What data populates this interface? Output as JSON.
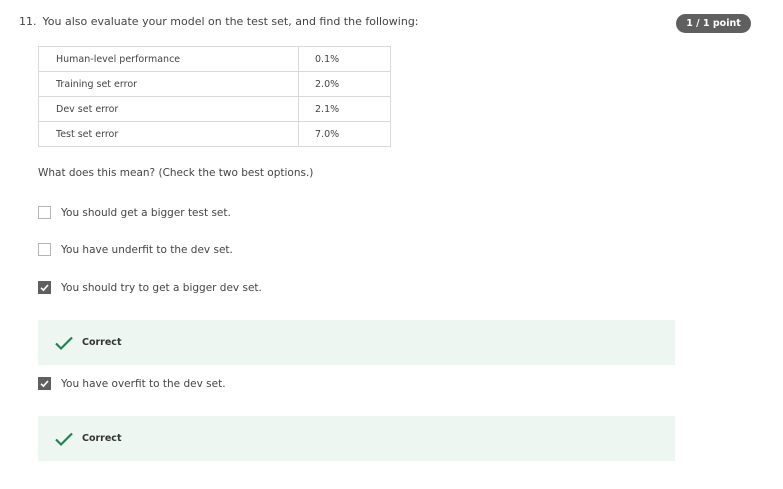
{
  "question": {
    "number": "11.",
    "text": "You also evaluate your model on the test set, and find the following:",
    "score": "1 / 1 point"
  },
  "table": {
    "rows": [
      {
        "metric": "Human-level performance",
        "value": "0.1%"
      },
      {
        "metric": "Training set error",
        "value": "2.0%"
      },
      {
        "metric": "Dev set error",
        "value": "2.1%"
      },
      {
        "metric": "Test set error",
        "value": "7.0%"
      }
    ]
  },
  "prompt": "What does this mean? (Check the two best options.)",
  "options": [
    {
      "label": "You should get a bigger test set.",
      "checked": false
    },
    {
      "label": "You have underfit to the dev set.",
      "checked": false
    },
    {
      "label": "You should try to get a bigger dev set.",
      "checked": true,
      "feedback": "Correct"
    },
    {
      "label": "You have overfit to the dev set.",
      "checked": true,
      "feedback": "Correct"
    }
  ],
  "colors": {
    "badge_bg": "#5f5f5f",
    "checkbox_checked": "#5f5f5f",
    "correct_icon": "#1f8354",
    "feedback_bg": "#eef6f2"
  },
  "icons": {
    "checkbox_check": "checkmark-icon",
    "feedback": "check-icon"
  }
}
